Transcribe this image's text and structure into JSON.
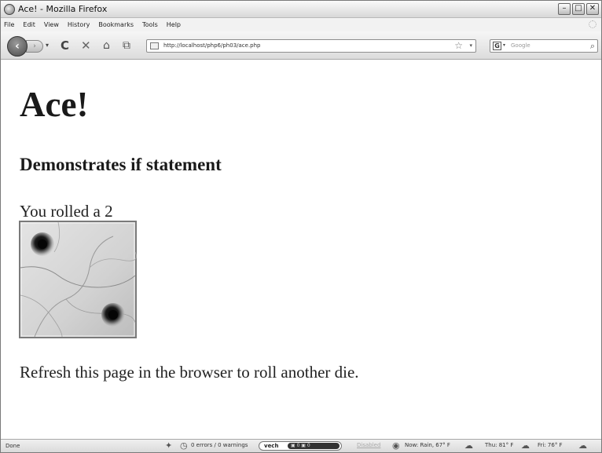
{
  "window": {
    "title": "Ace! - Mozilla Firefox",
    "controls": {
      "minimize": "–",
      "maximize": "□",
      "close": "✕"
    }
  },
  "menubar": {
    "items": [
      "File",
      "Edit",
      "View",
      "History",
      "Bookmarks",
      "Tools",
      "Help"
    ]
  },
  "toolbar": {
    "back": "‹",
    "forward": "›",
    "history_dropdown": "▾",
    "reload": "C",
    "stop": "✕",
    "home": "⌂",
    "bookmark_page": "⧉",
    "url": "http://localhost/php6/ph03/ace.php",
    "star": "☆",
    "url_dropdown": "▾",
    "search_engine": "G",
    "search_engine_dropdown": "▾",
    "search_placeholder": "Google",
    "search_go": "⌕"
  },
  "page": {
    "heading": "Ace!",
    "subheading": "Demonstrates if statement",
    "roll_text": "You rolled a 2",
    "die_value": 2,
    "footer_text": "Refresh this page in the browser to roll another die."
  },
  "statusbar": {
    "status": "Done",
    "errors": "0 errors / 0 warnings",
    "vech_label": "vech",
    "vech_counts": "▣ 0 ▣ 0",
    "disabled": "Disabled",
    "weather_now": "Now: Rain, 67° F",
    "weather_thu": "Thu: 81° F",
    "weather_fri": "Fri: 76° F"
  }
}
